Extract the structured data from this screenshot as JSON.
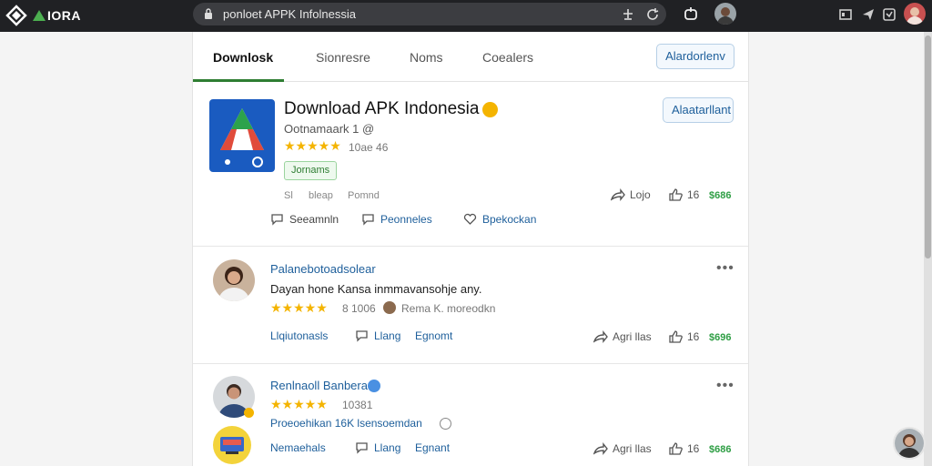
{
  "browser": {
    "brand": "IORA",
    "url": "ponloet APPK Infolnessia"
  },
  "tabs": [
    {
      "label": "Downlosk",
      "active": true
    },
    {
      "label": "Sionresre",
      "active": false
    },
    {
      "label": "Noms",
      "active": false
    },
    {
      "label": "Coealers",
      "active": false
    }
  ],
  "header_button": "Alardorlenv",
  "app": {
    "title": "Download APK Indonesia",
    "subtitle": "Ootnamaark 1 @",
    "rating_text": "10ae 46",
    "chip": "Jornams",
    "follow_button": "Alaatarllant",
    "meta": [
      "Sl",
      "bleap",
      "Pomnd"
    ],
    "share_label": "Lojo",
    "like_count": "16",
    "points": "$686",
    "actions": [
      {
        "label": "Seeamnln",
        "color": "gray"
      },
      {
        "label": "Peonneles",
        "color": "blue"
      },
      {
        "label": "Bpekockan",
        "color": "blue"
      }
    ]
  },
  "comments": [
    {
      "name": "Palanebotoadsolear",
      "text": "Dayan hone Kansa inmmavansohje any.",
      "rating_text": "8 1006",
      "mention": "Rema K. moreodkn",
      "actions": [
        "Llqiutonasls",
        "Llang",
        "Egnomt"
      ],
      "share_label": "Agri llas",
      "like_count": "16",
      "points": "$696"
    },
    {
      "name": "Renlnaoll Banbera",
      "rating_text": "10381",
      "text": "Proeoehikan 16K lsensoemdan",
      "actions": [
        "Nemaehals",
        "Llang",
        "Egnant"
      ],
      "share_label": "Agri llas",
      "like_count": "16",
      "points": "$686"
    }
  ],
  "colors": {
    "accent_blue": "#1e5f9b",
    "accent_green": "#2e9e44",
    "star": "#f4b400",
    "topbar": "#202124"
  }
}
